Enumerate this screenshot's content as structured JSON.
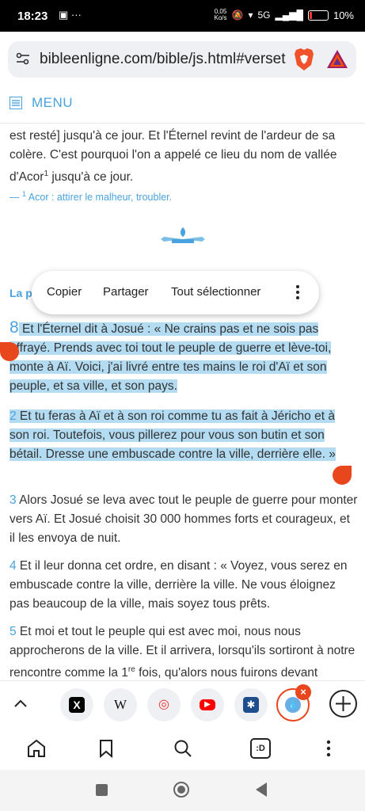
{
  "status": {
    "time": "18:23",
    "speed_value": "0,05",
    "speed_unit": "Ko/s",
    "battery_pct": "10%",
    "network": "5G"
  },
  "browser": {
    "url": "bibleenligne.com/bible/js.html#verset"
  },
  "menu": {
    "label": "MENU"
  },
  "content": {
    "prev_line1": "est resté] jusqu'à ce jour. Et l'Éternel revint de l'ardeur de sa",
    "prev_line2": "colère. C'est pourquoi l'on a appelé ce lieu du nom de vallée",
    "prev_line3a": "d'Acor",
    "prev_line3_sup": "1",
    "prev_line3b": " jusqu'à ce jour.",
    "footnote_dash": "— ",
    "footnote_sup": "1",
    "footnote_text": " Acor : attirer le malheur, troubler.",
    "section_partial": "La p",
    "verses": [
      {
        "num": "8",
        "text": " Et l'Éternel dit à Josué : « Ne crains pas et ne sois pas effrayé. Prends avec toi tout le peuple de guerre et lève-toi, monte à Aï. Voici, j'ai livré entre tes mains le roi d'Aï et son peuple, et sa ville, et son pays."
      },
      {
        "num": "2",
        "text": " Et tu feras à Aï et à son roi comme tu as fait à Jéricho et à son roi. Toutefois, vous pillerez pour vous son butin et son bétail. Dresse une embuscade contre la ville, derrière elle. »"
      },
      {
        "num": "3",
        "text": " Alors Josué se leva avec tout le peuple de guerre pour monter vers Aï. Et Josué choisit 30 000 hommes forts et courageux, et il les envoya de nuit."
      },
      {
        "num": "4",
        "text": " Et il leur donna cet ordre, en disant : « Voyez, vous serez en embuscade contre la ville, derrière la ville. Ne vous éloignez pas beaucoup de la ville, mais soyez tous prêts."
      },
      {
        "num": "5",
        "text_a": " Et moi et tout le peuple qui est avec moi, nous nous approcherons de la ville. Et il arrivera, lorsqu'ils sortiront à notre rencontre comme la 1",
        "sup": "re",
        "text_b": " fois, qu'alors nous fuirons devant"
      }
    ]
  },
  "context_menu": {
    "copy": "Copier",
    "share": "Partager",
    "select_all": "Tout sélectionner"
  },
  "tabs": [
    {
      "icon": "x-icon",
      "glyph": "X"
    },
    {
      "icon": "wikipedia-icon",
      "glyph": "W"
    },
    {
      "icon": "red-target-icon",
      "glyph": "◎"
    },
    {
      "icon": "youtube-icon",
      "glyph": "▶"
    },
    {
      "icon": "star-app-icon",
      "glyph": "✱"
    },
    {
      "icon": "bible-app-icon",
      "glyph": "💧"
    }
  ],
  "toolbar": {
    "tabs_count_label": ":D"
  },
  "colors": {
    "accent": "#4aa3df",
    "highlight": "#b3dcf3",
    "handle": "#e8461c"
  }
}
